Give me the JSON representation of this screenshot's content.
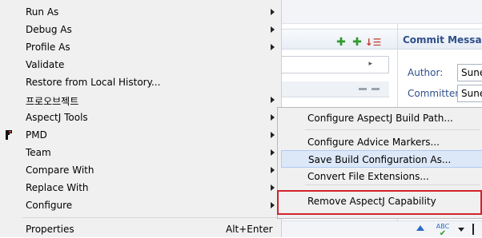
{
  "background": {
    "commit_panel": {
      "title": "Commit Message",
      "author_label": "Author:",
      "author_value": "Sune",
      "committer_label": "Committer:",
      "committer_value": "Sune"
    },
    "bottom_bar": {
      "spell_icon_text": "ABC"
    }
  },
  "main_menu": {
    "items": [
      {
        "label": "Run As",
        "submenu": true
      },
      {
        "label": "Debug As",
        "submenu": true
      },
      {
        "label": "Profile As",
        "submenu": true
      },
      {
        "label": "Validate",
        "submenu": false
      },
      {
        "label": "Restore from Local History...",
        "submenu": false
      },
      {
        "label": "프로오브젝트",
        "submenu": true
      },
      {
        "label": "AspectJ Tools",
        "submenu": true
      },
      {
        "label": "PMD",
        "submenu": true,
        "icon": "pmd-icon"
      },
      {
        "label": "Team",
        "submenu": true
      },
      {
        "label": "Compare With",
        "submenu": true
      },
      {
        "label": "Replace With",
        "submenu": true
      },
      {
        "label": "Configure",
        "submenu": true
      },
      {
        "label": "Properties",
        "accelerator": "Alt+Enter"
      }
    ]
  },
  "sub_menu": {
    "items": [
      {
        "label": "Configure AspectJ Build Path..."
      },
      {
        "label": "Configure Advice Markers..."
      },
      {
        "label": "Save Build Configuration As..."
      },
      {
        "label": "Convert File Extensions..."
      },
      {
        "label": "Remove AspectJ Capability"
      }
    ]
  },
  "colors": {
    "highlight_outline": "#d2232a",
    "hover": "#dce8f8",
    "menu_bg": "#f0f0f0"
  }
}
